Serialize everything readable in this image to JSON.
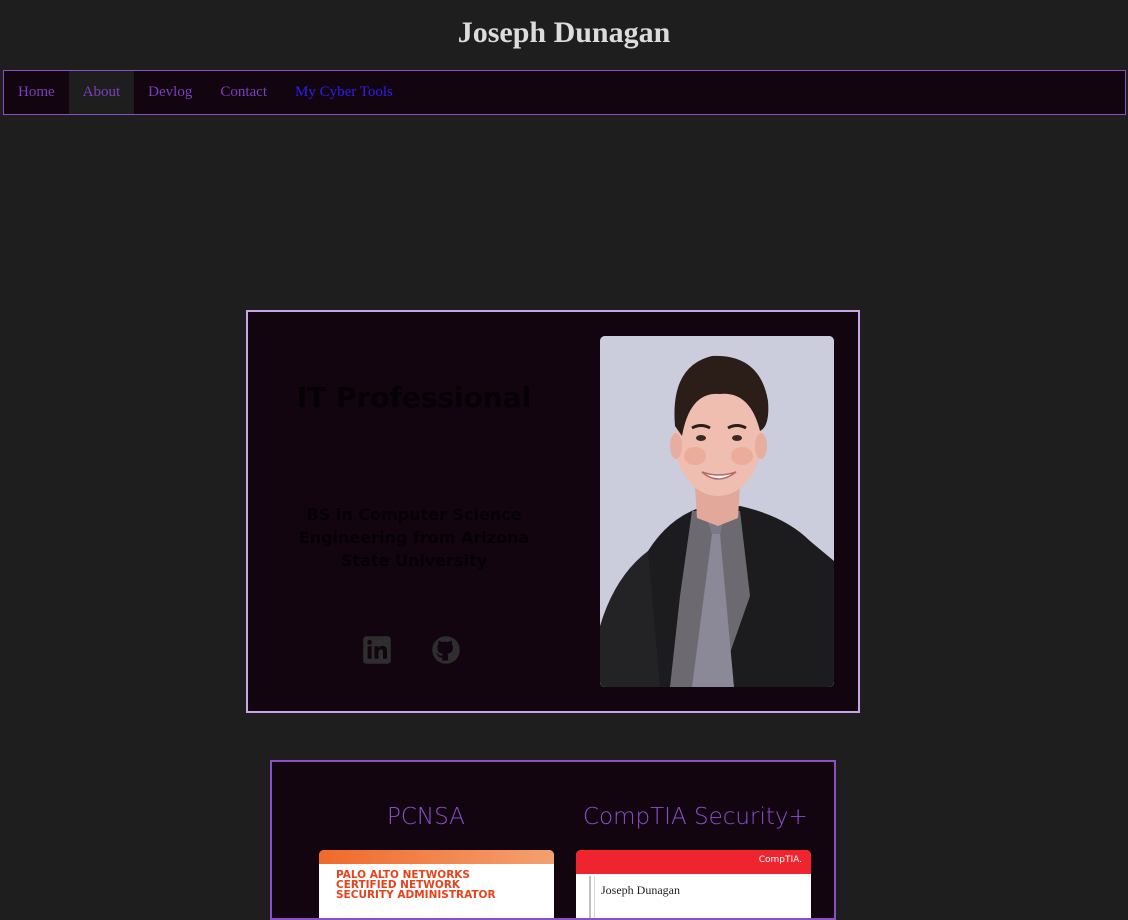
{
  "site": {
    "title": "Joseph Dunagan"
  },
  "nav": {
    "items": [
      {
        "label": "Home"
      },
      {
        "label": "About"
      },
      {
        "label": "Devlog"
      },
      {
        "label": "Contact"
      },
      {
        "label": "My Cyber Tools"
      }
    ],
    "active_index": 1
  },
  "profile": {
    "heading": "IT Professional",
    "subheading": "BS in Computer Science Engineering from Arizona State University",
    "social": [
      {
        "icon": "linkedin-icon"
      },
      {
        "icon": "github-icon"
      }
    ]
  },
  "certifications": [
    {
      "title": "PCNSA",
      "image_text": "PALO ALTO NETWORKS\nCERTIFIED NETWORK\nSECURITY ADMINISTRATOR"
    },
    {
      "title": "CompTIA Security+",
      "image_logo": "CompTIA.",
      "image_name": "Joseph Dunagan"
    }
  ],
  "colors": {
    "page_bg": "#1e1e1e",
    "card_bg": "#120510",
    "accent_purple": "#8a4fc4",
    "nav_link_blue": "#2b1ff0"
  }
}
